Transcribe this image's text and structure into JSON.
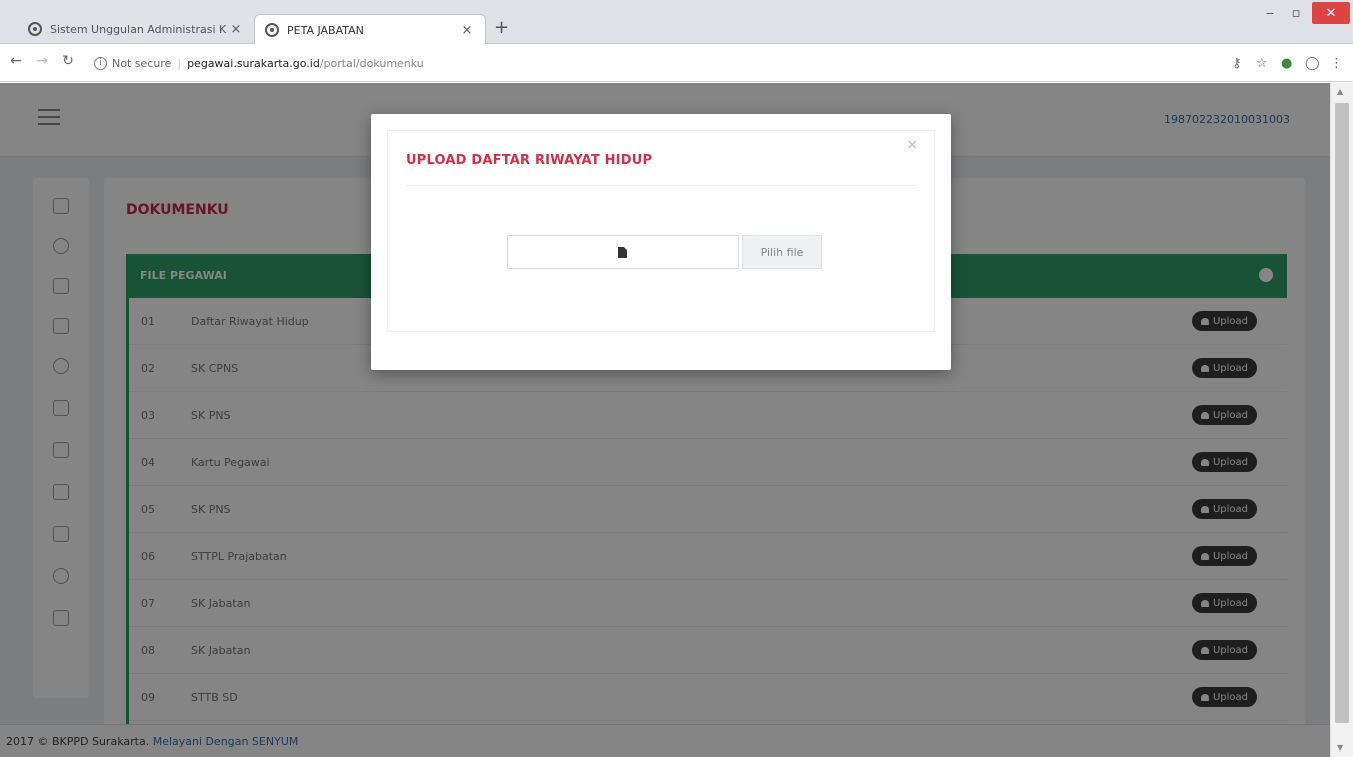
{
  "browser": {
    "tabs": [
      {
        "title": "Sistem Unggulan Administrasi K",
        "active": false
      },
      {
        "title": "PETA JABATAN",
        "active": true
      }
    ],
    "address": {
      "security_label": "Not secure",
      "host": "pegawai.surakarta.go.id",
      "path": "/portal/dokumenku"
    }
  },
  "header": {
    "user_nip": "198702232010031003"
  },
  "main": {
    "title": "DOKUMENKU",
    "panel_title": "FILE PEGAWAI",
    "upload_label": "Upload",
    "rows": [
      {
        "num": "01",
        "name": "Daftar Riwayat Hidup"
      },
      {
        "num": "02",
        "name": "SK CPNS"
      },
      {
        "num": "03",
        "name": "SK PNS"
      },
      {
        "num": "04",
        "name": "Kartu Pegawai"
      },
      {
        "num": "05",
        "name": "SK PNS"
      },
      {
        "num": "06",
        "name": "STTPL Prajabatan"
      },
      {
        "num": "07",
        "name": "SK Jabatan"
      },
      {
        "num": "08",
        "name": "SK Jabatan"
      },
      {
        "num": "09",
        "name": "STTB SD"
      }
    ]
  },
  "footer": {
    "text": "2017 © BKPPD Surakarta.",
    "link": "Melayani Dengan SENYUM"
  },
  "modal": {
    "title": "UPLOAD DAFTAR RIWAYAT HIDUP",
    "close_label": "×",
    "pick_file_label": "Pilih file"
  },
  "colors": {
    "accent_red": "#c42b4a",
    "panel_green": "#2e9f6b",
    "upload_badge": "#3a3a3a"
  }
}
